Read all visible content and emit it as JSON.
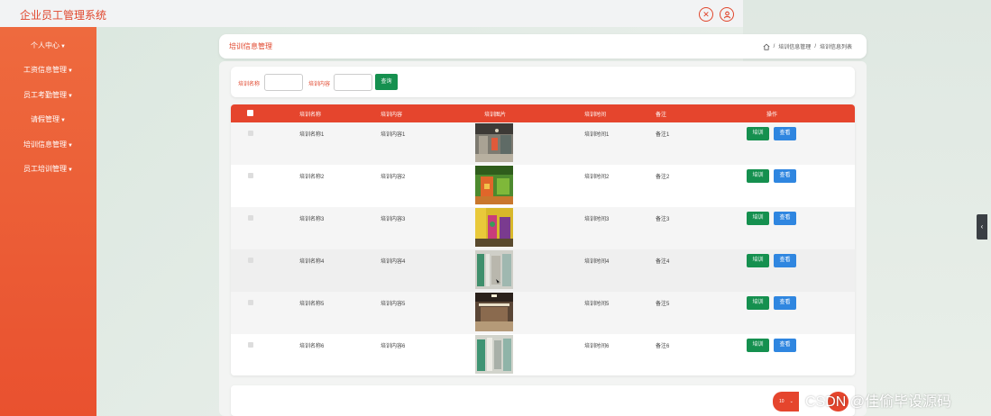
{
  "app": {
    "title": "企业员工管理系统"
  },
  "sidebar": {
    "items": [
      {
        "label": "个人中心"
      },
      {
        "label": "工资信息管理"
      },
      {
        "label": "员工考勤管理"
      },
      {
        "label": "请假管理"
      },
      {
        "label": "培训信息管理"
      },
      {
        "label": "员工培训管理"
      }
    ]
  },
  "header": {
    "title": "培训信息管理",
    "breadcrumb": [
      "培训信息管理",
      "培训信息列表"
    ],
    "separator": "/"
  },
  "search": {
    "fields": [
      {
        "label": "培训名称",
        "value": ""
      },
      {
        "label": "培训内容",
        "value": ""
      }
    ],
    "button_label": "查询"
  },
  "table": {
    "columns": [
      "培训名称",
      "培训内容",
      "培训图片",
      "培训时间",
      "备注",
      "操作"
    ],
    "rows": [
      {
        "name": "培训名称1",
        "content": "培训内容1",
        "image": "training-room-photo",
        "time": "培训时间1",
        "note": "备注1"
      },
      {
        "name": "培训名称2",
        "content": "培训内容2",
        "image": "classroom-green-photo",
        "time": "培训时间2",
        "note": "备注2"
      },
      {
        "name": "培训名称3",
        "content": "培训内容3",
        "image": "colorful-hall-photo",
        "time": "培训时间3",
        "note": "备注3"
      },
      {
        "name": "培训名称4",
        "content": "培训内容4",
        "image": "office-corridor-photo",
        "time": "培训时间4",
        "note": "备注4"
      },
      {
        "name": "培训名称5",
        "content": "培训内容5",
        "image": "meeting-room-photo",
        "time": "培训时间5",
        "note": "备注5"
      },
      {
        "name": "培训名称6",
        "content": "培训内容6",
        "image": "office-hallway-photo",
        "time": "培训时间6",
        "note": "备注6"
      }
    ],
    "action_labels": {
      "train": "培训",
      "view": "查看"
    }
  },
  "pagination": {
    "page_size": "10"
  },
  "watermark": "CSDN @佳偷毕设源码",
  "colors": {
    "accent": "#e5452d",
    "sidebar": "#ec5d35",
    "green_button": "#15904f",
    "blue_button": "#2f86e0"
  },
  "icons": {
    "top_close": "close-circle-icon",
    "top_user": "user-circle-icon",
    "home": "home-icon",
    "sidebar_caret": "caret-down-icon",
    "side_tab": "chevron-left-icon"
  }
}
